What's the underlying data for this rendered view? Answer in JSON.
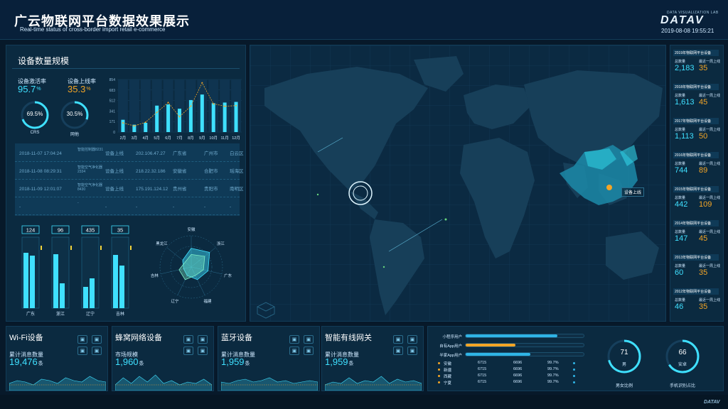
{
  "header": {
    "title": "广云物联网平台数据效果展示",
    "subtitle": "Real-time status of cross-border import retail e-commerce",
    "logo_tagline": "DATA VISUALIZATION LAB",
    "logo_text": "DATAV",
    "datetime": "2019-08-08 19:55:21"
  },
  "device_panel": {
    "title": "设备数量规模",
    "activation_label": "设备激活率",
    "activation_value": "95.7",
    "activation_unit": "%",
    "online_label": "设备上线率",
    "online_value": "35.3",
    "online_unit": "%",
    "ring1_value": "69.5%",
    "ring1_label": "CRS",
    "ring1_fraction": 0.695,
    "ring2_value": "30.5%",
    "ring2_label": "网他",
    "ring2_fraction": 0.305
  },
  "chart_data": [
    {
      "type": "bar",
      "categories": [
        "2月",
        "3月",
        "4月",
        "5月",
        "6月",
        "7月",
        "8月",
        "9月",
        "10月",
        "11月",
        "12月"
      ],
      "yticks": [
        "854",
        "683",
        "512",
        "341",
        "171",
        "0"
      ],
      "ylim": [
        0,
        854
      ],
      "series": [
        {
          "type": "bar",
          "values": [
            200,
            120,
            150,
            430,
            450,
            380,
            520,
            610,
            470,
            480,
            490
          ]
        },
        {
          "type": "line",
          "values": [
            150,
            100,
            160,
            320,
            480,
            250,
            420,
            800,
            460,
            420,
            430
          ]
        }
      ]
    },
    {
      "type": "radar",
      "axes": [
        "安徽",
        "浙江",
        "广东",
        "福建",
        "辽宁",
        "吉林",
        "黑龙江"
      ],
      "max": 100,
      "series": [
        {
          "values": [
            60,
            75,
            55,
            45,
            30,
            25,
            35
          ]
        },
        {
          "values": [
            40,
            55,
            40,
            30,
            45,
            40,
            25
          ]
        }
      ]
    },
    {
      "type": "bar",
      "categories": [
        "广东",
        "浙江",
        "辽宁",
        "吉林"
      ],
      "labels": [
        "124",
        "96",
        "435",
        "35"
      ],
      "ylim": [
        0,
        100
      ],
      "series": [
        {
          "values": [
            78,
            76,
            30,
            75
          ]
        },
        {
          "values": [
            74,
            35,
            42,
            60
          ]
        }
      ]
    }
  ],
  "log_table": {
    "rows": [
      {
        "time": "2018-11-07 17:04:24",
        "device": "智能控制器8231",
        "action": "设备上线",
        "ip": "202.106.47.27",
        "province": "广东省",
        "city": "广州市",
        "district": "白云区"
      },
      {
        "time": "2018-11-08 08:29:31",
        "device": "智能空气净化器2334",
        "action": "设备上线",
        "ip": "218.22.32.186",
        "province": "安徽省",
        "city": "合肥市",
        "district": "瑶海区"
      },
      {
        "time": "2018-11-09 12:01:07",
        "device": "智能空气净化器8430",
        "action": "设备上线",
        "ip": "175.191.124.12",
        "province": "贵州省",
        "city": "贵阳市",
        "district": "南明区"
      },
      {
        "time": "-",
        "device": "-",
        "action": "-",
        "ip": "-",
        "province": "-",
        "city": "-",
        "district": "-"
      }
    ]
  },
  "map": {
    "tooltip": "设备上线"
  },
  "side_years": [
    {
      "title": "2019年物联网平台设备",
      "label1": "总数量",
      "label2": "最近一周上线",
      "value1": "2,183",
      "value2": "35"
    },
    {
      "title": "2018年物联网平台设备",
      "label1": "总数量",
      "label2": "最近一周上线",
      "value1": "1,613",
      "value2": "45"
    },
    {
      "title": "2017年物联网平台设备",
      "label1": "总数量",
      "label2": "最近一周上线",
      "value1": "1,113",
      "value2": "50"
    },
    {
      "title": "2016年物联网平台设备",
      "label1": "总数量",
      "label2": "最近一周上线",
      "value1": "744",
      "value2": "89"
    },
    {
      "title": "2015年物联网平台设备",
      "label1": "总数量",
      "label2": "最近一周上线",
      "value1": "442",
      "value2": "109"
    },
    {
      "title": "2014年物联网平台设备",
      "label1": "总数量",
      "label2": "最近一周上线",
      "value1": "147",
      "value2": "45"
    },
    {
      "title": "2013年物联网平台设备",
      "label1": "总数量",
      "label2": "最近一周上线",
      "value1": "60",
      "value2": "35"
    },
    {
      "title": "2012年物联网平台设备",
      "label1": "总数量",
      "label2": "最近一周上线",
      "value1": "46",
      "value2": "35"
    }
  ],
  "bottom_cards": [
    {
      "title": "Wi-Fi设备",
      "metric": "累计消息数量",
      "value": "19,476",
      "unit": "条"
    },
    {
      "title": "蜂窝网络设备",
      "metric": "市场规模",
      "value": "1,960",
      "unit": "条"
    },
    {
      "title": "蓝牙设备",
      "metric": "累计消息数量",
      "value": "1,959",
      "unit": "条"
    },
    {
      "title": "智能有线网关",
      "metric": "累计消息数量",
      "value": "1,959",
      "unit": "条"
    }
  ],
  "users_panel": {
    "bars": [
      {
        "label": "小程序用户",
        "fraction": 0.78,
        "color": "#2fb4e6"
      },
      {
        "label": "自有App用户",
        "fraction": 0.42,
        "color": "#f3a526"
      },
      {
        "label": "半家App用户",
        "fraction": 0.55,
        "color": "#2fb4e6"
      }
    ],
    "table": [
      {
        "name": "安徽",
        "a": "6715",
        "b": "6696",
        "c": "99.7%"
      },
      {
        "name": "新疆",
        "a": "6715",
        "b": "6696",
        "c": "99.7%"
      },
      {
        "name": "西藏",
        "a": "6715",
        "b": "6696",
        "c": "99.7%"
      },
      {
        "name": "宁夏",
        "a": "6715",
        "b": "6696",
        "c": "99.7%"
      }
    ],
    "ring1_value": "71",
    "ring1_unit": "男",
    "ring1_fraction": 0.71,
    "ring1_caption": "男女比例",
    "ring2_value": "66",
    "ring2_unit": "安卓",
    "ring2_fraction": 0.66,
    "ring2_caption": "手机识别占比"
  },
  "colors": {
    "accent": "#3fe0ff",
    "orange": "#f3a526",
    "bg": "#07192a"
  }
}
